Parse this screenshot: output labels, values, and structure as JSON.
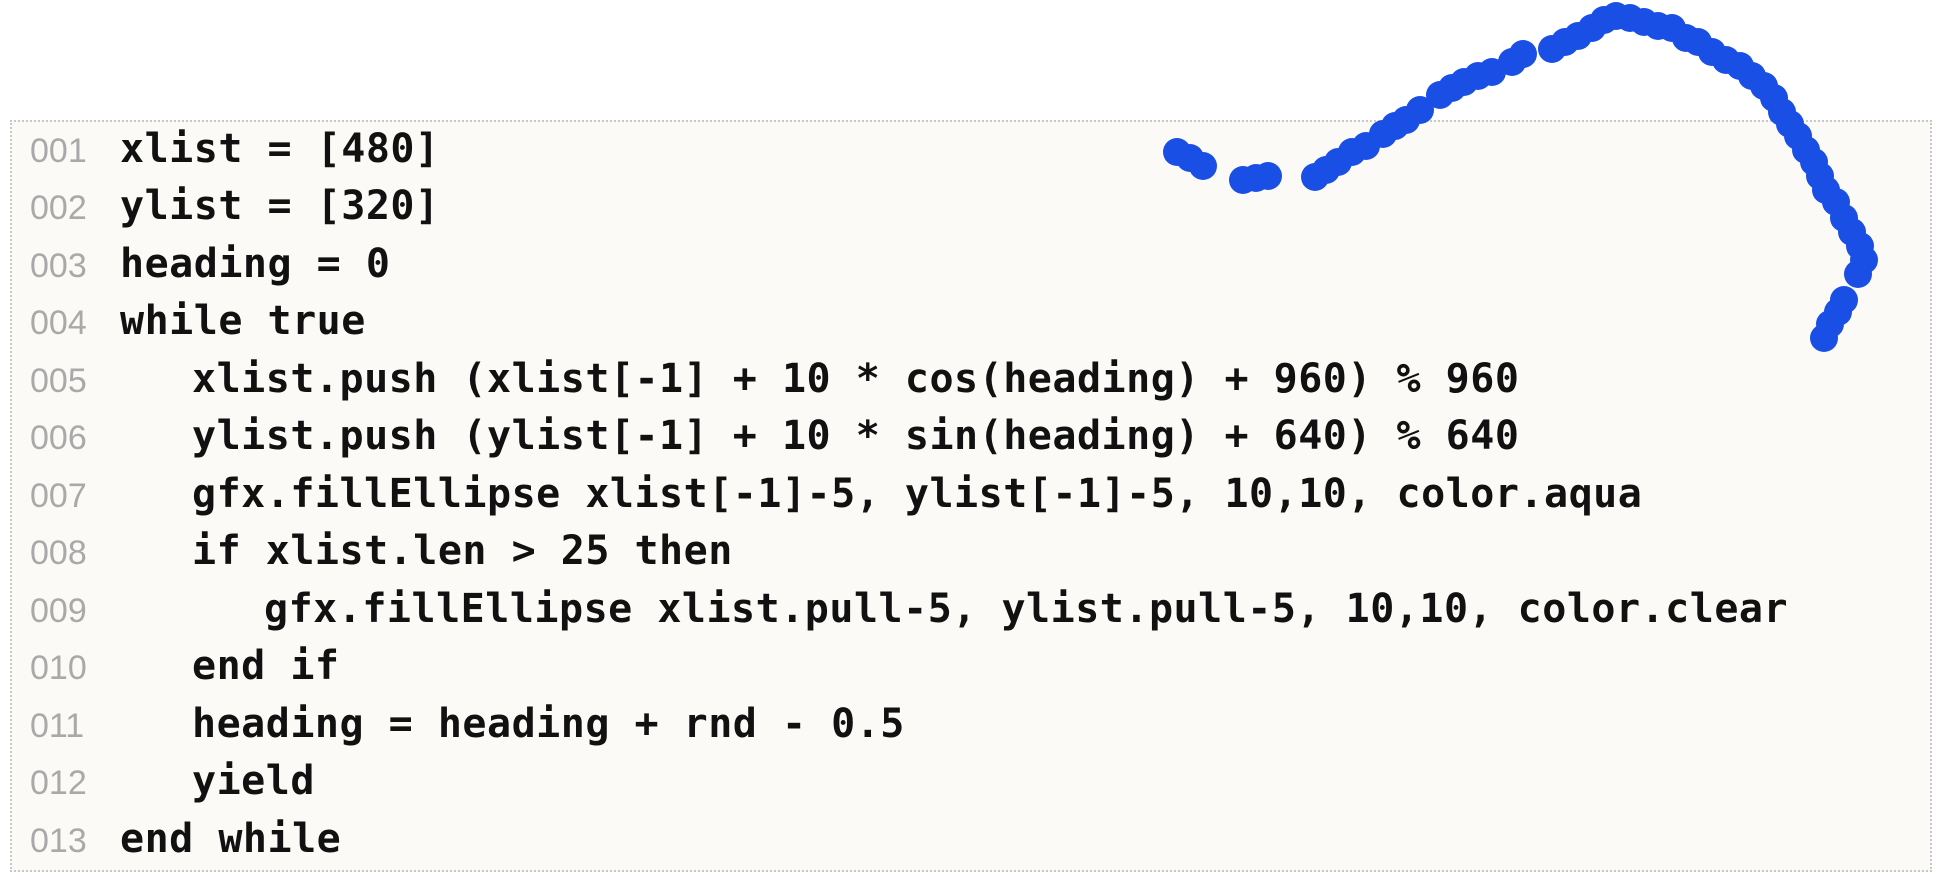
{
  "editor": {
    "lines": [
      {
        "number": "001",
        "indent": 0,
        "code": "xlist = [480]"
      },
      {
        "number": "002",
        "indent": 0,
        "code": "ylist = [320]"
      },
      {
        "number": "003",
        "indent": 0,
        "code": "heading = 0"
      },
      {
        "number": "004",
        "indent": 0,
        "code": "while true"
      },
      {
        "number": "005",
        "indent": 1,
        "code": "xlist.push (xlist[-1] + 10 * cos(heading) + 960) % 960"
      },
      {
        "number": "006",
        "indent": 1,
        "code": "ylist.push (ylist[-1] + 10 * sin(heading) + 640) % 640"
      },
      {
        "number": "007",
        "indent": 1,
        "code": "gfx.fillEllipse xlist[-1]-5, ylist[-1]-5, 10,10, color.aqua"
      },
      {
        "number": "008",
        "indent": 1,
        "code": "if xlist.len > 25 then"
      },
      {
        "number": "009",
        "indent": 2,
        "code": "gfx.fillEllipse xlist.pull-5, ylist.pull-5, 10,10, color.clear"
      },
      {
        "number": "010",
        "indent": 1,
        "code": "end if"
      },
      {
        "number": "011",
        "indent": 1,
        "code": "heading = heading + rnd - 0.5"
      },
      {
        "number": "012",
        "indent": 1,
        "code": "yield"
      },
      {
        "number": "013",
        "indent": 0,
        "code": "end while"
      }
    ]
  },
  "doodle": {
    "color": "#1a4fe6",
    "icon": "blue-worm-trail"
  }
}
